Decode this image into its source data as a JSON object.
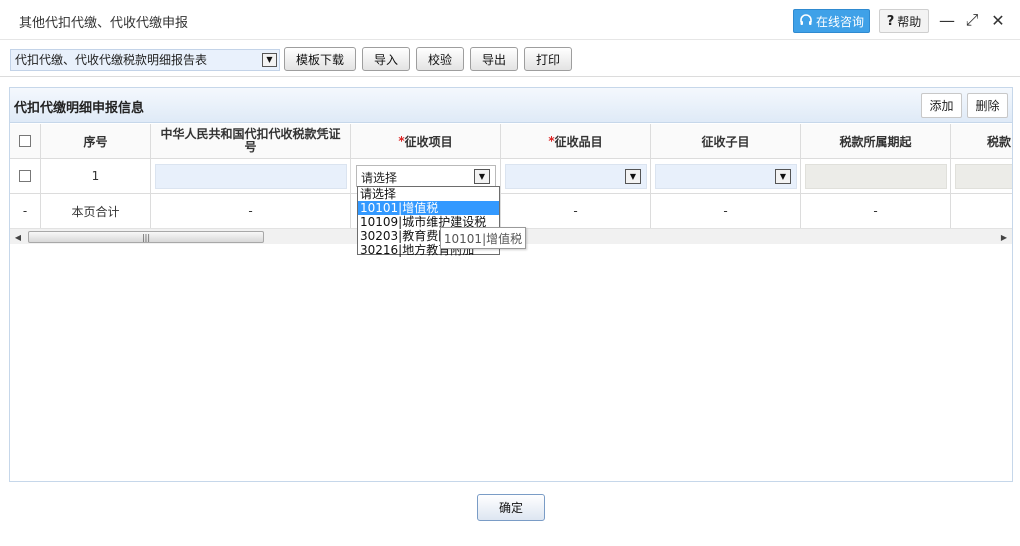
{
  "window": {
    "title": "其他代扣代缴、代收代缴申报",
    "consult_label": "在线咨询",
    "help_label": "帮助",
    "minimize_glyph": "—",
    "maximize_glyph": "⤢",
    "close_glyph": "✕"
  },
  "toolbar": {
    "report_type_value": "代扣代缴、代收代缴税款明细报告表",
    "buttons": [
      "模板下载",
      "导入",
      "校验",
      "导出",
      "打印"
    ]
  },
  "panel": {
    "title": "代扣代缴明细申报信息",
    "add_label": "添加",
    "delete_label": "删除"
  },
  "grid": {
    "columns": [
      "序号",
      "中华人民共和国代扣代收税款凭证号",
      "征收项目",
      "征收品目",
      "征收子目",
      "税款所属期起",
      "税款"
    ],
    "required_mark": "*",
    "rows": [
      {
        "seq": "1",
        "levy_item": "请选择"
      }
    ],
    "total_row": {
      "label": "本页合计",
      "dash": "-"
    }
  },
  "scrollbar": {
    "left_arrow": "◀",
    "right_arrow": "▶",
    "grip": "|||"
  },
  "dropdown": {
    "options": [
      "请选择",
      "10101|增值税",
      "10109|城市维护建设税",
      "30203|教育费附加",
      "30216|地方教育附加"
    ],
    "highlighted_index": 1
  },
  "tooltip": {
    "text": "10101|增值税"
  },
  "footer": {
    "confirm_label": "确定"
  },
  "colors": {
    "accent": "#3fa1e8",
    "highlight": "#3399ff",
    "required": "#dd2222",
    "input_bg": "#e8f0fb"
  }
}
